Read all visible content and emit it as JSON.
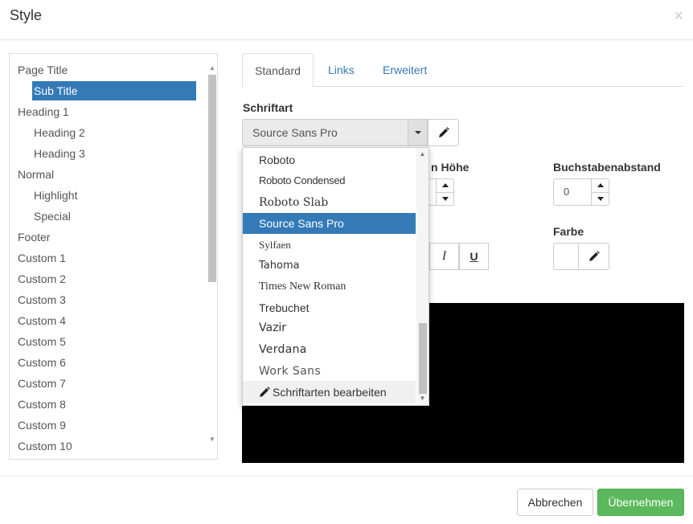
{
  "dialog": {
    "title": "Style",
    "close_glyph": "×"
  },
  "style_list": {
    "items": [
      {
        "label": "Page Title",
        "level": 0,
        "selected": false
      },
      {
        "label": "Sub Title",
        "level": 1,
        "selected": true
      },
      {
        "label": "Heading 1",
        "level": 0,
        "selected": false
      },
      {
        "label": "Heading 2",
        "level": 1,
        "selected": false
      },
      {
        "label": "Heading 3",
        "level": 1,
        "selected": false
      },
      {
        "label": "Normal",
        "level": 0,
        "selected": false
      },
      {
        "label": "Highlight",
        "level": 1,
        "selected": false
      },
      {
        "label": "Special",
        "level": 1,
        "selected": false
      },
      {
        "label": "Footer",
        "level": 0,
        "selected": false
      },
      {
        "label": "Custom 1",
        "level": 0,
        "selected": false
      },
      {
        "label": "Custom 2",
        "level": 0,
        "selected": false
      },
      {
        "label": "Custom 3",
        "level": 0,
        "selected": false
      },
      {
        "label": "Custom 4",
        "level": 0,
        "selected": false
      },
      {
        "label": "Custom 5",
        "level": 0,
        "selected": false
      },
      {
        "label": "Custom 6",
        "level": 0,
        "selected": false
      },
      {
        "label": "Custom 7",
        "level": 0,
        "selected": false
      },
      {
        "label": "Custom 8",
        "level": 0,
        "selected": false
      },
      {
        "label": "Custom 9",
        "level": 0,
        "selected": false
      },
      {
        "label": "Custom 10",
        "level": 0,
        "selected": false
      }
    ]
  },
  "tabs": [
    {
      "label": "Standard",
      "active": true
    },
    {
      "label": "Links",
      "active": false
    },
    {
      "label": "Erweitert",
      "active": false
    }
  ],
  "font": {
    "label": "Schriftart",
    "value": "Source Sans Pro"
  },
  "line_height": {
    "label_partial": "n Höhe"
  },
  "letter_spacing": {
    "label": "Buchstabenabstand",
    "value": "0"
  },
  "color": {
    "label": "Farbe"
  },
  "format_buttons": {
    "italic": "I",
    "underline": "U"
  },
  "font_dropdown": {
    "options": [
      {
        "label": "Roboto",
        "selected": false
      },
      {
        "label": "Roboto Condensed",
        "selected": false
      },
      {
        "label": "Roboto Slab",
        "selected": false
      },
      {
        "label": "Source Sans Pro",
        "selected": true
      },
      {
        "label": "Sylfaen",
        "selected": false
      },
      {
        "label": "Tahoma",
        "selected": false
      },
      {
        "label": "Times New Roman",
        "selected": false
      },
      {
        "label": "Trebuchet",
        "selected": false
      },
      {
        "label": "Vazir",
        "selected": false
      },
      {
        "label": "Verdana",
        "selected": false
      },
      {
        "label": "Work Sans",
        "selected": false
      }
    ],
    "edit_label": "Schriftarten bearbeiten"
  },
  "footer": {
    "cancel_label": "Abbrechen",
    "apply_label": "Übernehmen"
  },
  "colors": {
    "accent": "#337ab7",
    "success": "#5cb85c",
    "preview_bg": "#000000"
  }
}
